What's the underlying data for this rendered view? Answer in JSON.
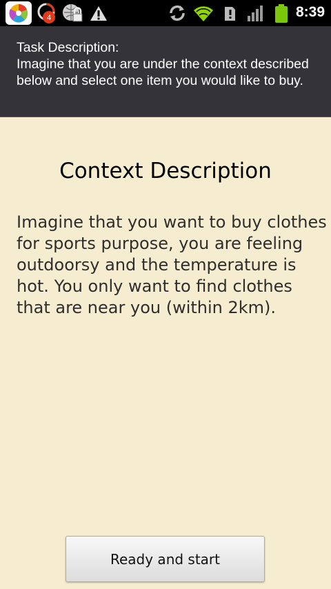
{
  "status_bar": {
    "notification_count": "4",
    "time": "8:39",
    "icons": [
      "app-launcher-icon",
      "notification-app-icon",
      "vpn-lock-icon",
      "warning-icon",
      "sync-icon",
      "wifi-icon",
      "sd-card-icon",
      "signal-icon",
      "battery-icon"
    ]
  },
  "task": {
    "title": "Task Description:",
    "text": "Imagine that you are under the context described below and select one item you would like to buy."
  },
  "context": {
    "title": "Context Description",
    "text": "Imagine that you want to buy clothes for sports purpose, you are feeling outdoorsy and the temperature is hot. You only want to find clothes that are near you (within 2km)."
  },
  "actions": {
    "start_label": "Ready and start"
  },
  "colors": {
    "background": "#f6edd0",
    "header": "#333338",
    "status_bar": "#000000",
    "wifi": "#8fd400",
    "battery": "#7ac70c",
    "badge": "#e03a1a"
  }
}
